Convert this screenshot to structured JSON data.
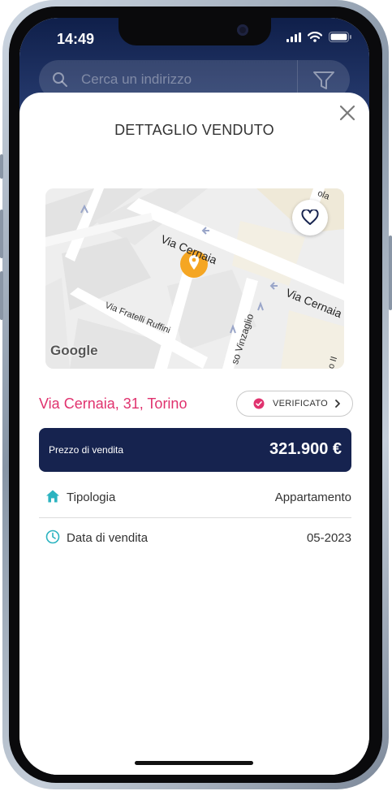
{
  "status_bar": {
    "time": "14:49"
  },
  "search": {
    "placeholder": "Cerca un indirizzo"
  },
  "sheet": {
    "title": "DETTAGLIO VENDUTO",
    "map": {
      "streets": [
        "Via Cernaia",
        "Via Cernaia",
        "Via Fratelli Ruffini",
        "so Vinzaglio",
        "ola",
        "o II"
      ],
      "attribution": "Google"
    },
    "address": "Via Cernaia, 31, Torino",
    "verified_label": "VERIFICATO",
    "price": {
      "label": "Prezzo di vendita",
      "value": "321.900 €"
    },
    "details": [
      {
        "label": "Tipologia",
        "value": "Appartamento",
        "icon": "home-icon"
      },
      {
        "label": "Data di vendita",
        "value": "05-2023",
        "icon": "clock-icon"
      }
    ]
  },
  "colors": {
    "accent": "#e0326e",
    "navy": "#16234f",
    "marker": "#f5a623",
    "icon_teal": "#2bb3c0"
  }
}
